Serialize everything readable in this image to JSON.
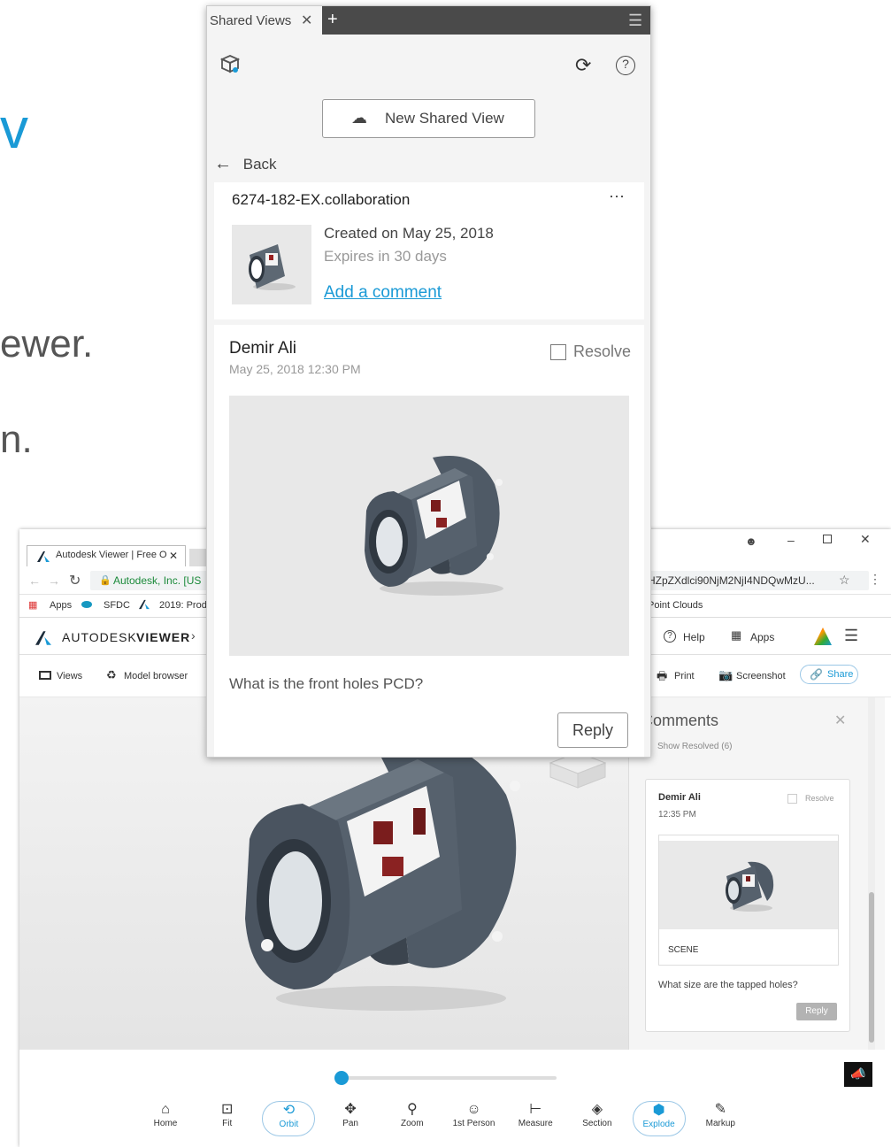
{
  "slide": {
    "title_fragment": "v",
    "line1_fragment": "ewer.",
    "line2_fragment": "n."
  },
  "browser": {
    "tab_title": "Autodesk Viewer | Free O",
    "secure_label": "Autodesk, Inc. [US",
    "url": "HZpZXdlci90NjM2NjI4NDQwMzU...",
    "bookmarks": {
      "apps": "Apps",
      "sfdc": "SFDC",
      "prod": "2019: Prod",
      "point_clouds": "Point Clouds"
    }
  },
  "app": {
    "brand": "AUTODESK",
    "brand_product": "VIEWER",
    "help": "Help",
    "apps": "Apps",
    "toolbar": {
      "views": "Views",
      "model_browser": "Model browser",
      "print": "Print",
      "screenshot": "Screenshot",
      "share": "Share"
    },
    "comments_panel": {
      "title": "Comments",
      "show_resolved": "Show Resolved (6)",
      "comment": {
        "author": "Demir Ali",
        "time": "12:35 PM",
        "resolve": "Resolve",
        "scene": "SCENE",
        "text": "What size are the tapped holes?",
        "reply": "Reply"
      }
    },
    "bottom_tools": [
      {
        "label": "Home",
        "icon": "home-icon"
      },
      {
        "label": "Fit",
        "icon": "fit-icon"
      },
      {
        "label": "Orbit",
        "icon": "orbit-icon",
        "active": true
      },
      {
        "label": "Pan",
        "icon": "pan-icon"
      },
      {
        "label": "Zoom",
        "icon": "zoom-icon"
      },
      {
        "label": "1st Person",
        "icon": "first-person-icon"
      },
      {
        "label": "Measure",
        "icon": "measure-icon"
      },
      {
        "label": "Section",
        "icon": "section-icon"
      },
      {
        "label": "Explode",
        "icon": "explode-icon",
        "active": true
      },
      {
        "label": "Markup",
        "icon": "markup-icon"
      }
    ]
  },
  "shared_views": {
    "tab_label": "Shared Views",
    "new_button": "New Shared View",
    "back": "Back",
    "view": {
      "name": "6274-182-EX.collaboration",
      "created": "Created on May 25, 2018",
      "expires": "Expires in 30 days",
      "add_comment": "Add a comment"
    },
    "comment": {
      "author": "Demir Ali",
      "date": "May 25, 2018 12:30 PM",
      "resolve": "Resolve",
      "text": "What is the front holes PCD?",
      "reply": "Reply"
    }
  },
  "colors": {
    "accent": "#1a9ad6",
    "model": "#4f5a66"
  }
}
